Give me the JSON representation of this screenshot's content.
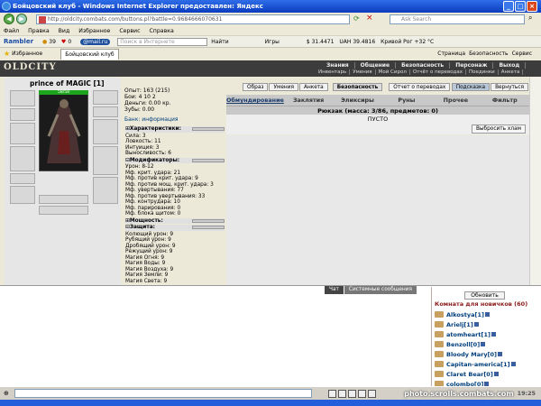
{
  "window": {
    "title": "Бойцовский клуб - Windows Internet Explorer предоставлен: Яндекс",
    "url": "http://oldcity.combats.com/buttons.pl?battle=0.9684666070631",
    "search_placeholder": "Ask Search"
  },
  "menu": [
    "Файл",
    "Правка",
    "Вид",
    "Избранное",
    "Сервис",
    "Справка"
  ],
  "toolbar1": {
    "rambler": "Rambler",
    "coins": "39",
    "hearts": "0",
    "mail": "@mail.ru",
    "search_placeholder": "Поиск в Интернете",
    "find": "Найти",
    "games": "Игры",
    "usd": "$ 31.4471",
    "uah": "UAH 39.4816",
    "city": "Кривой Рог +32 °C"
  },
  "toolbar2": {
    "favorites": "Избранное",
    "tab": "Бойцовский клуб",
    "page": "Страница",
    "security": "Безопасность",
    "service": "Сервис"
  },
  "game": {
    "logo": "OLDCITY",
    "topnav": [
      "Знания",
      "Общение",
      "Безопасность",
      "Персонаж",
      "Выход"
    ],
    "subnav": [
      "Инвентарь",
      "Умения",
      "Мой Сирол",
      "Отчёт о переводах",
      "Поединки",
      "Анкета"
    ],
    "char_name": "prince of MAGIC [1]",
    "hp_text": "58/58",
    "stats": [
      "Опыт: 163 (215)",
      "Бои: 4 10 2",
      "Деньги: 0.00 кр.",
      "Зубы: 0.00"
    ],
    "bank": "Банк: информация",
    "sections": {
      "chars": "Характеристики:",
      "mods": "Модификаторы:",
      "power": "Мощность:",
      "defense": "Защита:"
    },
    "characteristics": [
      "Сила: 3",
      "Ловкость: 11",
      "Интуиция: 3",
      "Выносливость: 6"
    ],
    "modifiers": [
      "Урон: 8-12",
      "Мф. крит. удара: 21",
      "Мф. против крит. удара: 9",
      "Мф. против мощ. крит. удара: 3",
      "Мф. увертывания: 77",
      "Мф. против увертывания: 33",
      "Мф. контрудара: 10",
      "Мф. парирования: 0",
      "Мф. блока щитом: 0"
    ],
    "defense": [
      "Колющий урон: 9",
      "Рубящий урон: 9",
      "Дробящий урон: 9",
      "Режущий урон: 9",
      "Магия Огня: 9",
      "Магия Воды: 9",
      "Магия Воздуха: 9",
      "Магия Земли: 9",
      "Магия Света: 9"
    ],
    "topbuttons": [
      "Образ",
      "Умения",
      "Анкета",
      "Безопасность",
      "Отчет о переводах",
      "Подсказка",
      "Вернуться"
    ],
    "tabs": [
      "Обмундирование",
      "Заклятия",
      "Эликсиры",
      "Руны",
      "Прочее",
      "Фильтр"
    ],
    "backpack": "Рюкзак (масса: 3/86, предметов: 0)",
    "empty": "ПУСТО",
    "throw": "Выбросить хлам"
  },
  "chat": {
    "tab_chat": "Чат",
    "tab_sys": "Системные сообщения",
    "refresh": "Обновить",
    "room": "Комната для новичков (60)",
    "users": [
      "Alkostya[1]",
      "Arielj[1]",
      "atomheart[1]",
      "Benzoll[0]",
      "Bloody Mary[0]",
      "Capitan-america[1]",
      "Claret Bear[0]",
      "colombo[0]"
    ]
  },
  "watermark": "photo.scrolls.combats.com",
  "clock": "19:25"
}
